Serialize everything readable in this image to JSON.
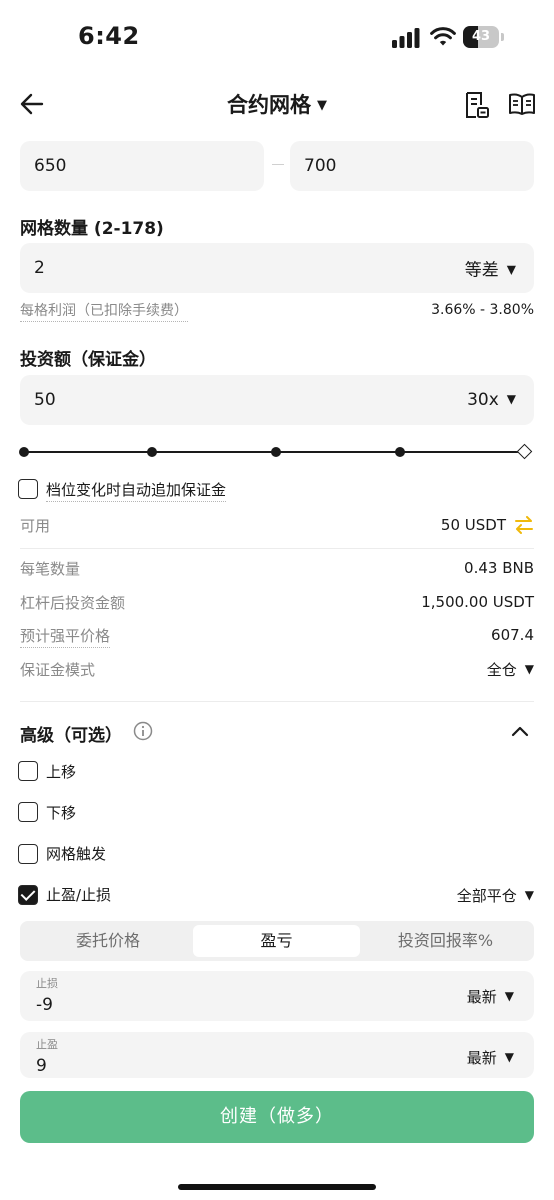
{
  "status": {
    "time": "6:42",
    "battery": "43",
    "battery_level": 0.43
  },
  "nav": {
    "title": "合约网格",
    "caret": "▼"
  },
  "price_range": {
    "low": "650",
    "high": "700"
  },
  "grid_count": {
    "label": "网格数量 (2-178)",
    "value": "2",
    "mode": "等差",
    "caret": "▼"
  },
  "profit": {
    "label": "每格利润（已扣除手续费）",
    "value": "3.66% - 3.80%"
  },
  "investment": {
    "label": "投资额（保证金）",
    "value": "50",
    "leverage": "30x",
    "caret": "▼"
  },
  "auto_margin": {
    "label": "档位变化时自动追加保证金",
    "checked": false
  },
  "available": {
    "label": "可用",
    "value": "50 USDT",
    "icon": "swap-icon",
    "icon_color": "#f0b90b"
  },
  "details": [
    {
      "label": "每笔数量",
      "value": "0.43 BNB"
    },
    {
      "label": "杠杆后投资金额",
      "value": "1,500.00 USDT"
    },
    {
      "label": "预计强平价格",
      "value": "607.4"
    },
    {
      "label": "保证金模式",
      "value": "全仓",
      "caret": "▼"
    }
  ],
  "advanced": {
    "title": "高级（可选）",
    "options": [
      {
        "label": "上移",
        "checked": false
      },
      {
        "label": "下移",
        "checked": false
      },
      {
        "label": "网格触发",
        "checked": false
      },
      {
        "label": "止盈/止损",
        "checked": true
      }
    ],
    "close_mode": "全部平仓",
    "caret": "▼"
  },
  "tabs": [
    {
      "label": "委托价格",
      "active": false
    },
    {
      "label": "盈亏",
      "active": true
    },
    {
      "label": "投资回报率%",
      "active": false
    }
  ],
  "stop_loss": {
    "caption": "止损",
    "value": "-9",
    "trigger": "最新",
    "caret": "▼"
  },
  "take_profit": {
    "caption": "止盈",
    "value": "9",
    "trigger": "最新",
    "caret": "▼"
  },
  "create_button": {
    "label": "创建（做多）",
    "color": "#5cbd8a"
  }
}
